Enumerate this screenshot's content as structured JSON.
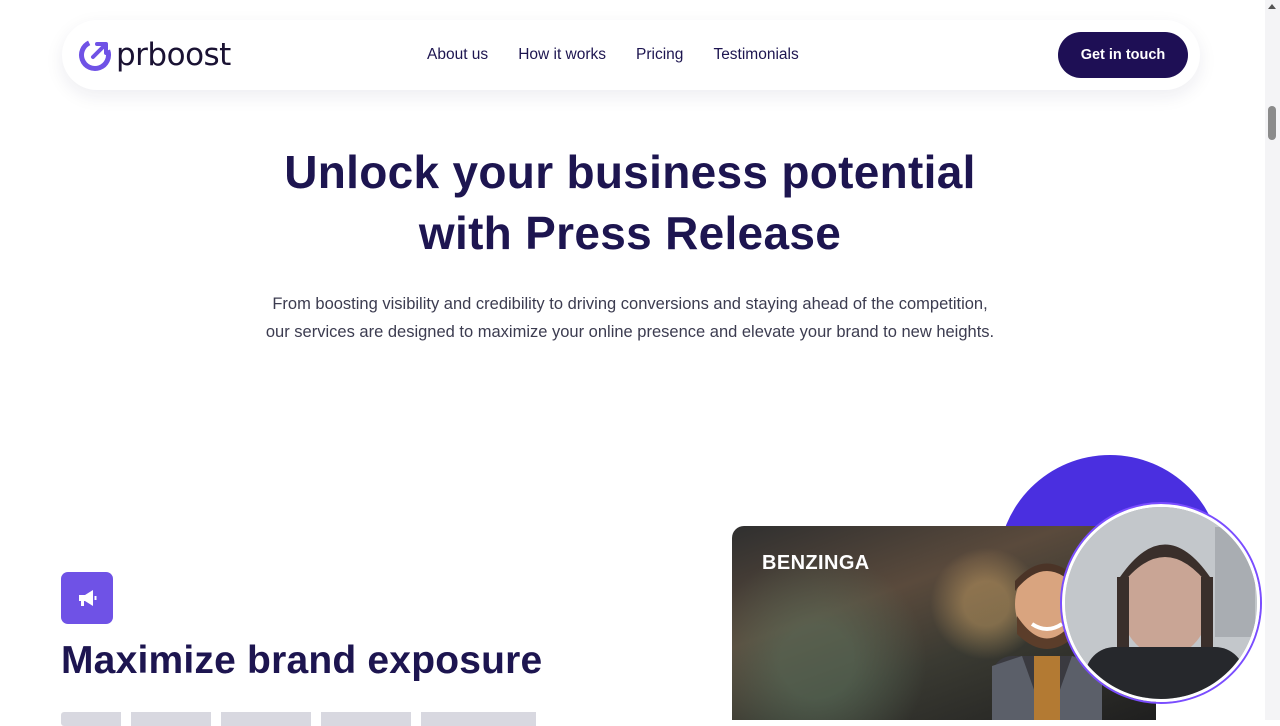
{
  "header": {
    "logo_text": "prboost",
    "nav": [
      "About us",
      "How it works",
      "Pricing",
      "Testimonials"
    ],
    "cta_label": "Get in touch"
  },
  "hero": {
    "title_line1": "Unlock your business potential",
    "title_line2": "with Press Release",
    "subtitle": "From boosting visibility and credibility to driving conversions and staying ahead of the competition, our services are designed to maximize your online presence and elevate your brand to new heights."
  },
  "feature": {
    "icon": "megaphone-icon",
    "title": "Maximize brand exposure"
  },
  "media": {
    "brand_label": "BENZINGA"
  },
  "colors": {
    "primary_dark": "#1e0f55",
    "accent_purple": "#6f52e6",
    "blob_blue": "#4a2fe0",
    "text_dark": "#1d1550"
  }
}
